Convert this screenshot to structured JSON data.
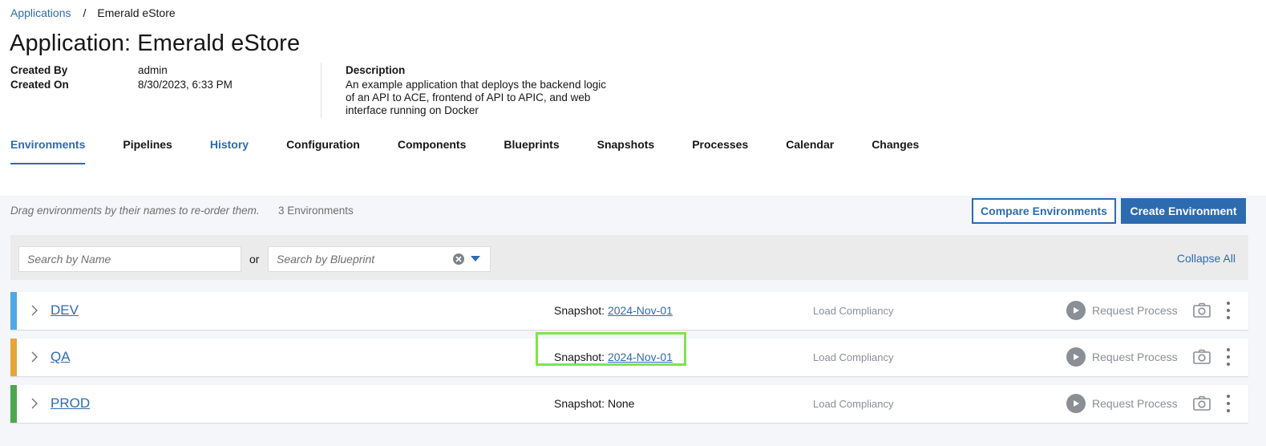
{
  "breadcrumb": {
    "root": "Applications",
    "separator": "/",
    "current": "Emerald eStore"
  },
  "page_title": "Application: Emerald eStore",
  "meta": {
    "created_by_label": "Created By",
    "created_by_value": "admin",
    "created_on_label": "Created On",
    "created_on_value": "8/30/2023, 6:33 PM",
    "description_label": "Description",
    "description_text": "An example application that deploys the backend logic of an API to ACE, frontend of API to APIC, and web interface running on Docker"
  },
  "tabs": [
    {
      "label": "Environments"
    },
    {
      "label": "Pipelines"
    },
    {
      "label": "History"
    },
    {
      "label": "Configuration"
    },
    {
      "label": "Components"
    },
    {
      "label": "Blueprints"
    },
    {
      "label": "Snapshots"
    },
    {
      "label": "Processes"
    },
    {
      "label": "Calendar"
    },
    {
      "label": "Changes"
    }
  ],
  "toolbar": {
    "drag_hint": "Drag environments by their names to re-order them.",
    "env_count": "3 Environments",
    "compare_label": "Compare Environments",
    "create_label": "Create Environment"
  },
  "filters": {
    "name_placeholder": "Search by Name",
    "or_label": "or",
    "blueprint_placeholder": "Search by Blueprint",
    "collapse_all": "Collapse All"
  },
  "environments": [
    {
      "name": "DEV",
      "color": "#4da9e8",
      "snapshot_label": "Snapshot:",
      "snapshot_value": "2024-Nov-01",
      "load_compliancy": "Load Compliancy",
      "request_process": "Request Process"
    },
    {
      "name": "QA",
      "color": "#e8a63a",
      "snapshot_label": "Snapshot:",
      "snapshot_value": "2024-Nov-01",
      "load_compliancy": "Load Compliancy",
      "request_process": "Request Process"
    },
    {
      "name": "PROD",
      "color": "#4aa84f",
      "snapshot_label": "Snapshot:",
      "snapshot_value": "None",
      "load_compliancy": "Load Compliancy",
      "request_process": "Request Process"
    }
  ],
  "colors": {
    "accent": "#2d6bb0",
    "highlight_box": "#7ee352"
  }
}
